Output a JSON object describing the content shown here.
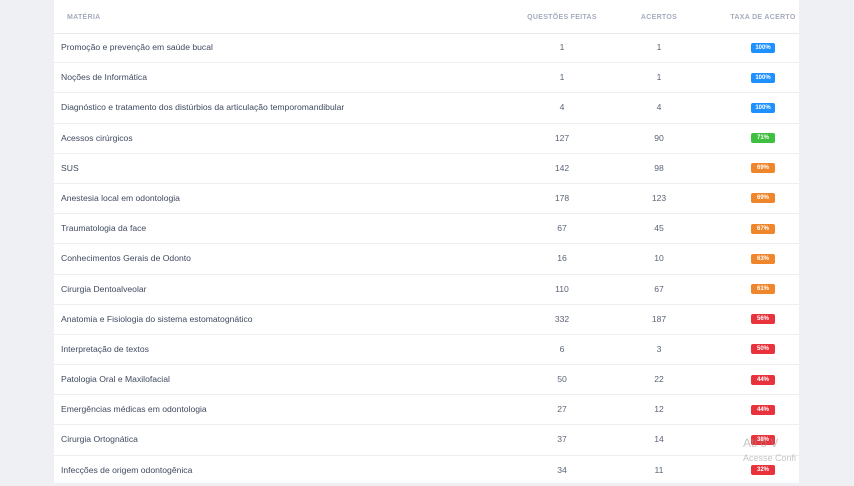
{
  "table": {
    "headers": {
      "materia": "MATÉRIA",
      "questoes_feitas": "QUESTÕES FEITAS",
      "acertos": "ACERTOS",
      "taxa_de_acerto": "TAXA DE ACERTO"
    },
    "rows": [
      {
        "materia": "Promoção e prevenção em saúde bucal",
        "feitas": "1",
        "acertos": "1",
        "taxa": "100%",
        "color": "#1e90ff"
      },
      {
        "materia": "Noções de Informática",
        "feitas": "1",
        "acertos": "1",
        "taxa": "100%",
        "color": "#1e90ff"
      },
      {
        "materia": "Diagnóstico e tratamento dos distúrbios da articulação temporomandibular",
        "feitas": "4",
        "acertos": "4",
        "taxa": "100%",
        "color": "#1e90ff"
      },
      {
        "materia": "Acessos cirúrgicos",
        "feitas": "127",
        "acertos": "90",
        "taxa": "71%",
        "color": "#3fbf3f"
      },
      {
        "materia": "SUS",
        "feitas": "142",
        "acertos": "98",
        "taxa": "69%",
        "color": "#f0862c"
      },
      {
        "materia": "Anestesia local em odontologia",
        "feitas": "178",
        "acertos": "123",
        "taxa": "69%",
        "color": "#f0862c"
      },
      {
        "materia": "Traumatologia da face",
        "feitas": "67",
        "acertos": "45",
        "taxa": "67%",
        "color": "#f0862c"
      },
      {
        "materia": "Conhecimentos Gerais de Odonto",
        "feitas": "16",
        "acertos": "10",
        "taxa": "63%",
        "color": "#f0862c"
      },
      {
        "materia": "Cirurgia Dentoalveolar",
        "feitas": "110",
        "acertos": "67",
        "taxa": "61%",
        "color": "#f0862c"
      },
      {
        "materia": "Anatomia e Fisiologia do sistema estomatognático",
        "feitas": "332",
        "acertos": "187",
        "taxa": "56%",
        "color": "#e8333c"
      },
      {
        "materia": "Interpretação de textos",
        "feitas": "6",
        "acertos": "3",
        "taxa": "50%",
        "color": "#e8333c"
      },
      {
        "materia": "Patologia Oral e Maxilofacial",
        "feitas": "50",
        "acertos": "22",
        "taxa": "44%",
        "color": "#e8333c"
      },
      {
        "materia": "Emergências médicas em odontologia",
        "feitas": "27",
        "acertos": "12",
        "taxa": "44%",
        "color": "#e8333c"
      },
      {
        "materia": "Cirurgia Ortognática",
        "feitas": "37",
        "acertos": "14",
        "taxa": "38%",
        "color": "#e8333c"
      },
      {
        "materia": "Infecções de origem odontogênica",
        "feitas": "34",
        "acertos": "11",
        "taxa": "32%",
        "color": "#e8333c"
      }
    ]
  },
  "watermark": {
    "line1": "Ati     o V",
    "line2": "Acesse Confi"
  }
}
